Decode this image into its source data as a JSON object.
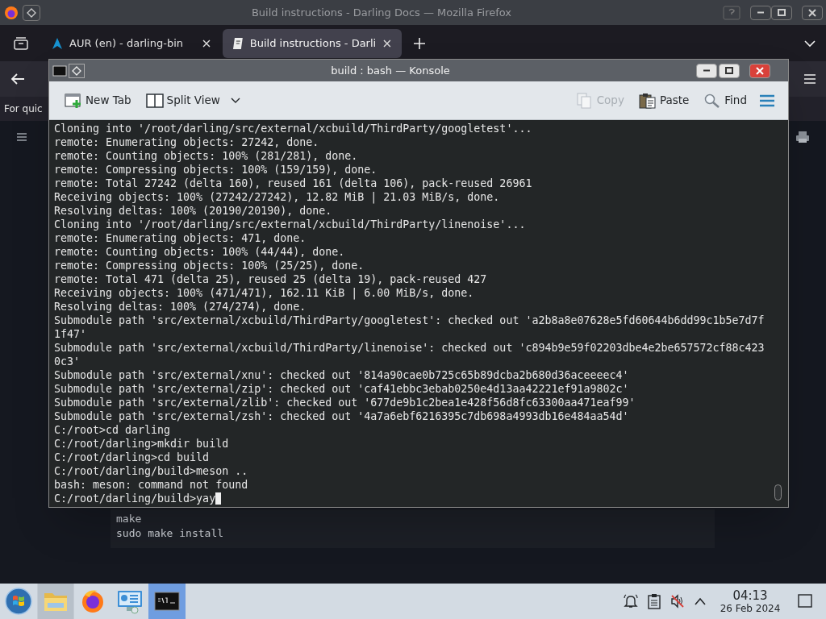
{
  "firefox": {
    "title": "Build instructions - Darling Docs — Mozilla Firefox",
    "tabs": [
      {
        "label": "AUR (en) - darling-bin",
        "selected": false
      },
      {
        "label": "Build instructions - Darli",
        "selected": true
      }
    ],
    "page": {
      "intro_text": "For quic",
      "code_lines": [
        "make",
        "sudo make install"
      ]
    }
  },
  "konsole": {
    "title": "build : bash — Konsole",
    "toolbar": [
      {
        "kind": "new-tab",
        "label": "New Tab",
        "disabled": false
      },
      {
        "kind": "split-view",
        "label": "Split View",
        "disabled": false
      },
      {
        "kind": "copy",
        "label": "Copy",
        "disabled": true
      },
      {
        "kind": "paste",
        "label": "Paste",
        "disabled": false
      },
      {
        "kind": "find",
        "label": "Find",
        "disabled": false
      }
    ],
    "terminal": {
      "lines": [
        "Cloning into '/root/darling/src/external/xcbuild/ThirdParty/googletest'...",
        "remote: Enumerating objects: 27242, done.",
        "remote: Counting objects: 100% (281/281), done.",
        "remote: Compressing objects: 100% (159/159), done.",
        "remote: Total 27242 (delta 160), reused 161 (delta 106), pack-reused 26961",
        "Receiving objects: 100% (27242/27242), 12.82 MiB | 21.03 MiB/s, done.",
        "Resolving deltas: 100% (20190/20190), done.",
        "Cloning into '/root/darling/src/external/xcbuild/ThirdParty/linenoise'...",
        "remote: Enumerating objects: 471, done.",
        "remote: Counting objects: 100% (44/44), done.",
        "remote: Compressing objects: 100% (25/25), done.",
        "remote: Total 471 (delta 25), reused 25 (delta 19), pack-reused 427",
        "Receiving objects: 100% (471/471), 162.11 KiB | 6.00 MiB/s, done.",
        "Resolving deltas: 100% (274/274), done.",
        "Submodule path 'src/external/xcbuild/ThirdParty/googletest': checked out 'a2b8a8e07628e5fd60644b6dd99c1b5e7d7f",
        "1f47'",
        "Submodule path 'src/external/xcbuild/ThirdParty/linenoise': checked out 'c894b9e59f02203dbe4e2be657572cf88c423",
        "0c3'",
        "Submodule path 'src/external/xnu': checked out '814a90cae0b725c65b89dcba2b680d36aceeeec4'",
        "Submodule path 'src/external/zip': checked out 'caf41ebbc3ebab0250e4d13aa42221ef91a9802c'",
        "Submodule path 'src/external/zlib': checked out '677de9b1c2bea1e428f56d8fc63300aa471eaf99'",
        "Submodule path 'src/external/zsh': checked out '4a7a6ebf6216395c7db698a4993db16e484aa54d'",
        "C:/root>cd darling",
        "C:/root/darling>mkdir build",
        "C:/root/darling>cd build",
        "C:/root/darling/build>meson ..",
        "bash: meson: command not found"
      ],
      "prompt_line": "C:/root/darling/build>yay"
    }
  },
  "taskbar": {
    "apps": [
      {
        "kind": "start",
        "selected": false,
        "highlighted": false
      },
      {
        "kind": "files",
        "selected": false,
        "highlighted": true
      },
      {
        "kind": "browser",
        "selected": false,
        "highlighted": false
      },
      {
        "kind": "settings",
        "selected": false,
        "highlighted": false
      },
      {
        "kind": "terminal",
        "selected": true,
        "highlighted": false
      }
    ],
    "tray": [
      {
        "kind": "notifications"
      },
      {
        "kind": "clipboard"
      },
      {
        "kind": "volume-muted"
      },
      {
        "kind": "expand"
      }
    ],
    "clock": {
      "time": "04:13",
      "date": "26 Feb 2024"
    }
  }
}
